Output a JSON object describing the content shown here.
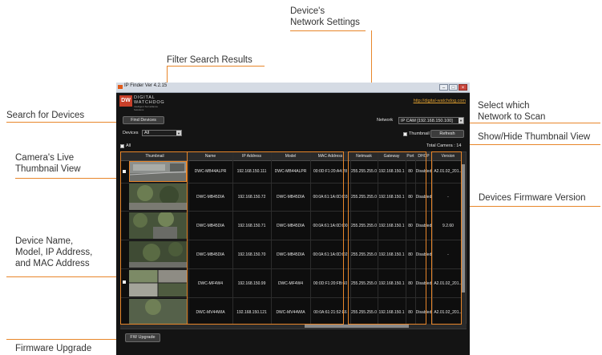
{
  "callouts": {
    "network_settings": [
      "Device's",
      "Network Settings"
    ],
    "filter": "Filter Search Results",
    "search": "Search for Devices",
    "select_network": [
      "Select which",
      "Network to Scan"
    ],
    "thumb_toggle": "Show/Hide Thumbnail View",
    "live_thumb": [
      "Camera's Live",
      "Thumbnail View"
    ],
    "firmware_version": "Devices Firmware Version",
    "device_info": [
      "Device Name,",
      "Model, IP Address,",
      "and MAC Address"
    ],
    "firmware_upgrade": "Firmware Upgrade"
  },
  "app": {
    "window_title": "IP Finder Ver 4.2.15",
    "brand_line1": "DIGITAL",
    "brand_line2": "WATCHDOG",
    "brand_tagline": "Intelligent Surveillance Solutions",
    "logo_mark": "DW",
    "website": "http://digital-watchdog.com",
    "find_button": "Find Devices",
    "devices_label": "Devices",
    "devices_filter": "All",
    "network_label": "Network",
    "network_value": "IP CAM [192.168.150.100]",
    "thumbnail_label": "Thumbnail",
    "refresh_button": "Refresh",
    "all_label": "All",
    "total_camera": "Total Camera : 14",
    "fw_upgrade_button": "FW Upgrade"
  },
  "columns": [
    "Thumbnail",
    "Name",
    "IP Address",
    "Model",
    "MAC Address",
    "Netmask",
    "Gateway",
    "Port",
    "DHCP",
    "Version"
  ],
  "rows": [
    {
      "name": "DWC-MB44ALPR",
      "ip": "192.168.150.111",
      "model": "DWC-MB44ALPR",
      "mac": "00:0D:F1:20:A4:28",
      "netmask": "255.255.255.0",
      "gateway": "192.168.150.1",
      "port": "80",
      "dhcp": "Disabled",
      "version": "A2.01.02_201..."
    },
    {
      "name": "DWC-MB45DIA",
      "ip": "192.168.150.72",
      "model": "DWC-MB45DIA",
      "mac": "00:0A:61:1A:0D:D3",
      "netmask": "255.255.255.0",
      "gateway": "192.168.150.1",
      "port": "80",
      "dhcp": "Disabled",
      "version": "-"
    },
    {
      "name": "DWC-MB45DIA",
      "ip": "192.168.150.71",
      "model": "DWC-MB45DIA",
      "mac": "00:0A:61:1A:0D:D0",
      "netmask": "255.255.255.0",
      "gateway": "192.168.150.1",
      "port": "80",
      "dhcp": "Disabled",
      "version": "9.2.60"
    },
    {
      "name": "DWC-MB45DIA",
      "ip": "192.168.150.70",
      "model": "DWC-MB45DIA",
      "mac": "00:0A:61:1A:0D:D2",
      "netmask": "255.255.255.0",
      "gateway": "192.168.150.1",
      "port": "80",
      "dhcp": "Disabled",
      "version": "-"
    },
    {
      "name": "DWC-MF4W4",
      "ip": "192.168.150.99",
      "model": "DWC-MF4W4",
      "mac": "00:0D:F1:20:FB:60",
      "netmask": "255.255.255.0",
      "gateway": "192.168.150.1",
      "port": "80",
      "dhcp": "Disabled",
      "version": "A2.01.02_201..."
    },
    {
      "name": "DWC-MV44WIA",
      "ip": "192.168.150.121",
      "model": "DWC-MV44WIA",
      "mac": "00:0A:61:21:52:E6",
      "netmask": "255.255.255.0",
      "gateway": "192.168.150.1",
      "port": "80",
      "dhcp": "Disabled",
      "version": "A2.01.02_201..."
    }
  ],
  "colors": {
    "accent": "#e8862a",
    "app_bg": "#141414",
    "link": "#e0a030",
    "logo_red": "#c9402a"
  }
}
